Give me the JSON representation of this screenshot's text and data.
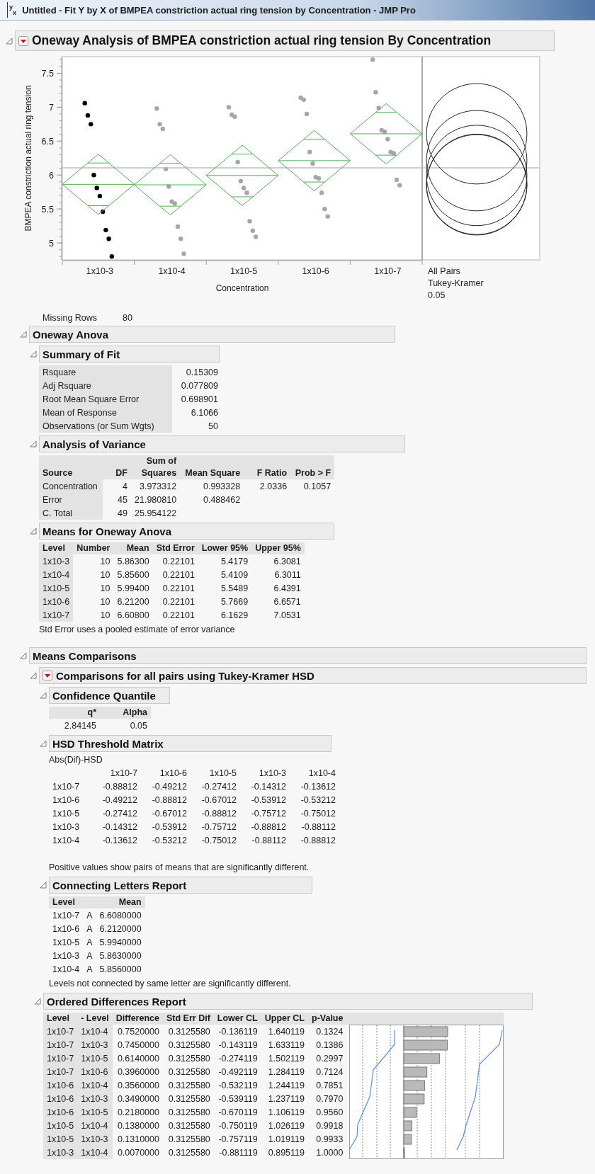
{
  "window": {
    "icon": "$^{y}$$_{x}$",
    "title": "Untitled - Fit Y by X of BMPEA constriction actual ring tension by Concentration - JMP Pro"
  },
  "oneway": {
    "header": {
      "title": "Oneway Analysis of BMPEA constriction actual ring tension By Concentration",
      "expanded": true,
      "menu": true
    },
    "chart_data": {
      "type": "scatter",
      "xlabel": "Concentration",
      "ylabel": "BMPEA constriction actual ring tension",
      "ylim": [
        4.75,
        7.745
      ],
      "yticks": [
        5,
        5.5,
        6,
        6.5,
        7,
        7.5
      ],
      "categories": [
        null,
        null,
        null,
        null,
        null,
        null,
        null,
        null,
        null,
        null,
        null,
        null,
        "1x10-3",
        null,
        null,
        null,
        null,
        null,
        null,
        null,
        null,
        null,
        null,
        null,
        null,
        null,
        null,
        null,
        null,
        null,
        null,
        null,
        null,
        null,
        null,
        null,
        "1x10-4",
        null,
        null,
        null,
        null,
        null,
        null,
        null,
        null,
        null,
        null,
        null,
        null,
        null,
        null,
        null,
        null,
        null,
        null,
        null,
        null,
        null,
        null,
        null,
        "1x10-5",
        null,
        null,
        null,
        null,
        null,
        null,
        null,
        null,
        null,
        null,
        null,
        null,
        null,
        null,
        null,
        null,
        null,
        null,
        null,
        null,
        null,
        null,
        null,
        "1x10-6",
        null,
        null,
        null,
        null,
        null,
        null,
        null,
        null,
        null,
        null,
        null,
        null,
        null,
        null,
        null,
        null,
        null,
        null,
        null,
        null,
        null,
        null,
        null,
        "1x10-7",
        null,
        null,
        null,
        null,
        null,
        null,
        null,
        null,
        null,
        null,
        null
      ],
      "series": [
        {
          "color": "#000000",
          "values": [
            null,
            null,
            null,
            null,
            null,
            null,
            null,
            7.06,
            6.88,
            6.75,
            6.0,
            5.81,
            5.69,
            5.46,
            5.19,
            5.06,
            4.8,
            null,
            null,
            null,
            null,
            null,
            null,
            null,
            null,
            null,
            null,
            null,
            null,
            null,
            null,
            null,
            null,
            null,
            null,
            null,
            null,
            null,
            null,
            null,
            null,
            null,
            null,
            null,
            null,
            null,
            null,
            null,
            null,
            null,
            null,
            null,
            null,
            null,
            null,
            null,
            null,
            null,
            null,
            null,
            null,
            null,
            null,
            null,
            null,
            null,
            null,
            null,
            null,
            null,
            null,
            null,
            null,
            null,
            null,
            null,
            null,
            null,
            null,
            null,
            null,
            null,
            null,
            null,
            null,
            null,
            null,
            null,
            null,
            null,
            null,
            null,
            null,
            null,
            null,
            null,
            null,
            null,
            null,
            null,
            null,
            null,
            null,
            null,
            null,
            null,
            null,
            null,
            null,
            null,
            null,
            null,
            null,
            null,
            null,
            null,
            null,
            null,
            null,
            null
          ]
        },
        {
          "color": "#a6a6a6",
          "values": [
            null,
            null,
            null,
            null,
            null,
            null,
            null,
            null,
            null,
            null,
            null,
            null,
            null,
            null,
            null,
            null,
            null,
            null,
            null,
            null,
            null,
            null,
            null,
            null,
            null,
            null,
            null,
            null,
            null,
            null,
            null,
            6.98,
            6.75,
            6.68,
            6.09,
            5.83,
            5.61,
            5.58,
            5.24,
            5.06,
            4.84,
            null,
            null,
            null,
            null,
            null,
            null,
            null,
            null,
            null,
            null,
            null,
            null,
            null,
            null,
            7.0,
            6.89,
            6.86,
            6.19,
            5.91,
            5.81,
            5.74,
            5.32,
            5.18,
            5.09,
            null,
            null,
            null,
            null,
            null,
            null,
            null,
            null,
            null,
            null,
            null,
            null,
            null,
            null,
            7.14,
            7.11,
            6.9,
            6.34,
            6.17,
            5.97,
            5.95,
            5.74,
            5.5,
            5.39,
            null,
            null,
            null,
            null,
            null,
            null,
            null,
            null,
            null,
            null,
            null,
            null,
            null,
            null,
            7.7,
            7.22,
            6.99,
            6.66,
            6.64,
            6.53,
            6.34,
            6.32,
            5.93,
            5.85,
            null,
            null,
            null,
            null,
            null,
            null,
            null
          ]
        }
      ]
    },
    "circles_labels": [
      "All Pairs",
      "Tukey-Kramer",
      "0.05"
    ]
  },
  "missing_rows": {
    "label": "Missing Rows",
    "value": "80"
  },
  "anova": {
    "header": {
      "title": "Oneway Anova",
      "expanded": true
    },
    "summary_of_fit": {
      "header": {
        "title": "Summary of Fit",
        "expanded": true
      },
      "rows": [
        [
          "Rsquare",
          "0.15309"
        ],
        [
          "Adj Rsquare",
          "0.077809"
        ],
        [
          "Root Mean Square Error",
          "0.698901"
        ],
        [
          "Mean of Response",
          "6.1066"
        ],
        [
          "Observations (or Sum Wgts)",
          "50"
        ]
      ]
    },
    "analysis_of_variance": {
      "header": {
        "title": "Analysis of Variance",
        "expanded": true
      },
      "header_rows": [
        [
          null,
          null,
          "Sum of",
          null,
          null,
          null
        ],
        [
          "Source",
          "DF",
          "Squares",
          "Mean Square",
          "F Ratio",
          "Prob > F"
        ]
      ],
      "rows": [
        [
          "Concentration",
          "4",
          "3.973312",
          "0.993328",
          "2.0336",
          "0.1057"
        ],
        [
          "Error",
          "45",
          "21.980810",
          "0.488462"
        ],
        [
          "C. Total",
          "49",
          "25.954122"
        ]
      ]
    },
    "means": {
      "header": {
        "title": "Means for Oneway Anova",
        "expanded": true
      },
      "columns": [
        "Level",
        "Number",
        "Mean",
        "Std Error",
        "Lower 95%",
        "Upper 95%"
      ],
      "rows": [
        [
          "1x10-3",
          "10",
          "5.86300",
          "0.22101",
          "5.4179",
          "6.3081"
        ],
        [
          "1x10-4",
          "10",
          "5.85600",
          "0.22101",
          "5.4109",
          "6.3011"
        ],
        [
          "1x10-5",
          "10",
          "5.99400",
          "0.22101",
          "5.5489",
          "6.4391"
        ],
        [
          "1x10-6",
          "10",
          "6.21200",
          "0.22101",
          "5.7669",
          "6.6571"
        ],
        [
          "1x10-7",
          "10",
          "6.60800",
          "0.22101",
          "6.1629",
          "7.0531"
        ]
      ],
      "note": "Std Error uses a pooled estimate of error variance"
    }
  },
  "means_comparisons": {
    "header": {
      "title": "Means Comparisons",
      "expanded": true
    },
    "tukey": {
      "header": {
        "title": "Comparisons for all pairs using Tukey-Kramer HSD",
        "expanded": true,
        "menu": true
      },
      "confidence_quantile": {
        "header": {
          "title": "Confidence Quantile",
          "expanded": true
        },
        "columns": [
          "q*",
          "Alpha"
        ],
        "rows": [
          [
            "2.84145",
            "0.05"
          ]
        ]
      },
      "hsd_matrix": {
        "header": {
          "title": "HSD Threshold Matrix",
          "expanded": true
        },
        "caption": "Abs(Dif)-HSD",
        "columns": [
          "1x10-7",
          "1x10-6",
          "1x10-5",
          "1x10-3",
          "1x10-4"
        ],
        "rows": [
          {
            "level": "1x10-7",
            "values": [
              "-0.88812",
              "-0.49212",
              "-0.27412",
              "-0.14312",
              "-0.13612"
            ]
          },
          {
            "level": "1x10-6",
            "values": [
              "-0.49212",
              "-0.88812",
              "-0.67012",
              "-0.53912",
              "-0.53212"
            ]
          },
          {
            "level": "1x10-5",
            "values": [
              "-0.27412",
              "-0.67012",
              "-0.88812",
              "-0.75712",
              "-0.75012"
            ]
          },
          {
            "level": "1x10-3",
            "values": [
              "-0.14312",
              "-0.53912",
              "-0.75712",
              "-0.88812",
              "-0.88112"
            ]
          },
          {
            "level": "1x10-4",
            "values": [
              "-0.13612",
              "-0.53212",
              "-0.75012",
              "-0.88112",
              "-0.88812"
            ]
          }
        ],
        "note": "Positive values show pairs of means that are significantly different."
      },
      "connecting_letters": {
        "header": {
          "title": "Connecting Letters Report",
          "expanded": true
        },
        "columns": [
          "Level",
          "Mean"
        ],
        "rows": [
          {
            "level": "1x10-7",
            "letter": "A",
            "mean": "6.6080000"
          },
          {
            "level": "1x10-6",
            "letter": "A",
            "mean": "6.2120000"
          },
          {
            "level": "1x10-5",
            "letter": "A",
            "mean": "5.9940000"
          },
          {
            "level": "1x10-3",
            "letter": "A",
            "mean": "5.8630000"
          },
          {
            "level": "1x10-4",
            "letter": "A",
            "mean": "5.8560000"
          }
        ],
        "note": "Levels not connected by same letter are significantly different."
      },
      "ordered_differences": {
        "header": {
          "title": "Ordered Differences Report",
          "expanded": true
        },
        "columns": [
          "Level",
          "- Level",
          "Difference",
          "Std Err Dif",
          "Lower CL",
          "Upper CL",
          "p-Value"
        ],
        "rows": [
          {
            "cells": [
              "1x10-7",
              "1x10-4",
              "0.7520000",
              "0.3125580",
              "-0.136119",
              "1.640119",
              "0.1324"
            ]
          },
          {
            "cells": [
              "1x10-7",
              "1x10-3",
              "0.7450000",
              "0.3125580",
              "-0.143119",
              "1.633119",
              "0.1386"
            ]
          },
          {
            "cells": [
              "1x10-7",
              "1x10-5",
              "0.6140000",
              "0.3125580",
              "-0.274119",
              "1.502119",
              "0.2997"
            ]
          },
          {
            "cells": [
              "1x10-7",
              "1x10-6",
              "0.3960000",
              "0.3125580",
              "-0.492119",
              "1.284119",
              "0.7124"
            ]
          },
          {
            "cells": [
              "1x10-6",
              "1x10-4",
              "0.3560000",
              "0.3125580",
              "-0.532119",
              "1.244119",
              "0.7851"
            ]
          },
          {
            "cells": [
              "1x10-6",
              "1x10-3",
              "0.3490000",
              "0.3125580",
              "-0.539119",
              "1.237119",
              "0.7970"
            ]
          },
          {
            "cells": [
              "1x10-6",
              "1x10-5",
              "0.2180000",
              "0.3125580",
              "-0.670119",
              "1.106119",
              "0.9560"
            ]
          },
          {
            "cells": [
              "1x10-5",
              "1x10-4",
              "0.1380000",
              "0.3125580",
              "-0.750119",
              "1.026119",
              "0.9918"
            ]
          },
          {
            "cells": [
              "1x10-5",
              "1x10-3",
              "0.1310000",
              "0.3125580",
              "-0.757119",
              "1.019119",
              "0.9933"
            ]
          },
          {
            "cells": [
              "1x10-3",
              "1x10-4",
              "0.0070000",
              "0.3125580",
              "-0.881119",
              "0.895119",
              "1.0000"
            ]
          }
        ]
      }
    }
  }
}
